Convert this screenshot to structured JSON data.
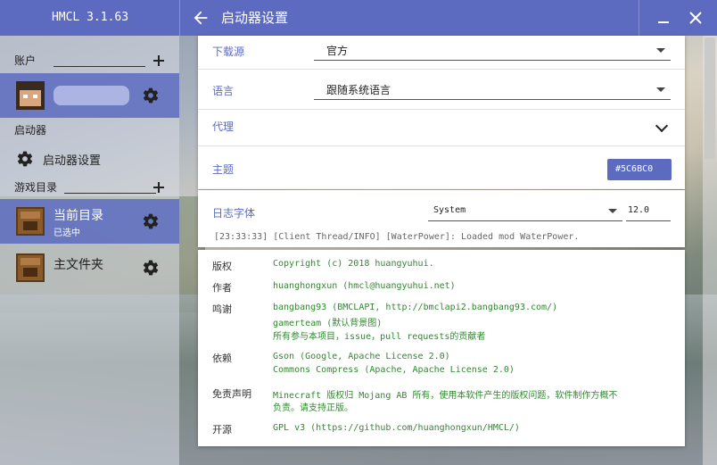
{
  "app": {
    "title": "HMCL 3.1.63"
  },
  "header": {
    "title": "启动器设置"
  },
  "sidebar": {
    "account_section": "账户",
    "launcher_section": "启动器",
    "launcher_settings": "启动器设置",
    "game_dir_section": "游戏目录",
    "dirs": [
      {
        "name": "当前目录",
        "status": "已选中"
      },
      {
        "name": "主文件夹"
      }
    ]
  },
  "settings": {
    "download_source": {
      "label": "下载源",
      "value": "官方"
    },
    "language": {
      "label": "语言",
      "value": "跟随系统语言"
    },
    "proxy": {
      "label": "代理"
    },
    "theme": {
      "label": "主题",
      "color": "#5C6BC0"
    },
    "log_font": {
      "label": "日志字体",
      "font": "System",
      "size": "12.0",
      "preview": "[23:33:33] [Client Thread/INFO] [WaterPower]: Loaded mod WaterPower."
    }
  },
  "about": {
    "copyright": {
      "label": "版权",
      "value": "Copyright (c) 2018 huangyuhui."
    },
    "author": {
      "label": "作者",
      "value": "huanghongxun (hmcl@huangyuhui.net)"
    },
    "thanks": {
      "label": "鸣谢",
      "lines": [
        "bangbang93 (BMCLAPI, http://bmclapi2.bangbang93.com/)",
        "gamerteam (默认背景图)",
        "所有参与本项目，issue，pull requests的贡献者"
      ]
    },
    "deps": {
      "label": "依赖",
      "lines": [
        "Gson (Google, Apache License 2.0)",
        "Commons Compress (Apache, Apache License 2.0)"
      ]
    },
    "disclaimer": {
      "label": "免责声明",
      "lines": [
        "Minecraft 版权归 Mojang AB 所有，使用本软件产生的版权问题，软件制作方概不",
        "负责。请支持正版。"
      ]
    },
    "open_source": {
      "label": "开源",
      "value": "GPL v3 (https://github.com/huanghongxun/HMCL/)"
    }
  }
}
